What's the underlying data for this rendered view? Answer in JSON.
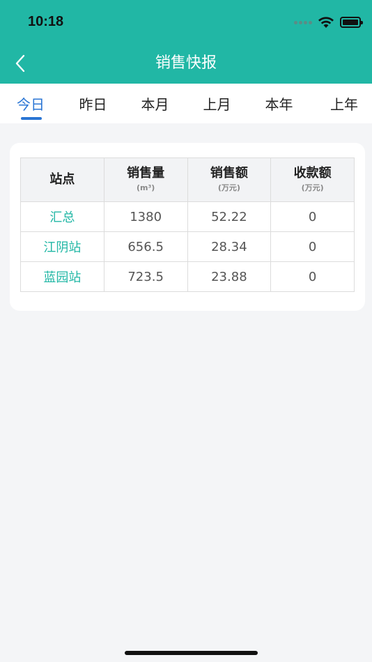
{
  "status_bar": {
    "time": "10:18"
  },
  "nav": {
    "title": "销售快报",
    "back_icon": "chevron-left-icon"
  },
  "tabs": [
    {
      "label": "今日",
      "active": true
    },
    {
      "label": "昨日",
      "active": false
    },
    {
      "label": "本月",
      "active": false
    },
    {
      "label": "上月",
      "active": false
    },
    {
      "label": "本年",
      "active": false
    },
    {
      "label": "上年",
      "active": false
    }
  ],
  "table": {
    "headers": [
      {
        "label": "站点",
        "unit": ""
      },
      {
        "label": "销售量",
        "unit": "(m³)"
      },
      {
        "label": "销售额",
        "unit": "(万元)"
      },
      {
        "label": "收款额",
        "unit": "(万元)"
      }
    ],
    "rows": [
      {
        "station": "汇总",
        "volume": "1380",
        "sales": "52.22",
        "receipts": "0"
      },
      {
        "station": "江阴站",
        "volume": "656.5",
        "sales": "28.34",
        "receipts": "0"
      },
      {
        "station": "蓝园站",
        "volume": "723.5",
        "sales": "23.88",
        "receipts": "0"
      }
    ]
  },
  "colors": {
    "header": "#21b7a5",
    "active_tab": "#2a75d4",
    "station_link": "#21b7a5",
    "background": "#f4f5f7"
  }
}
